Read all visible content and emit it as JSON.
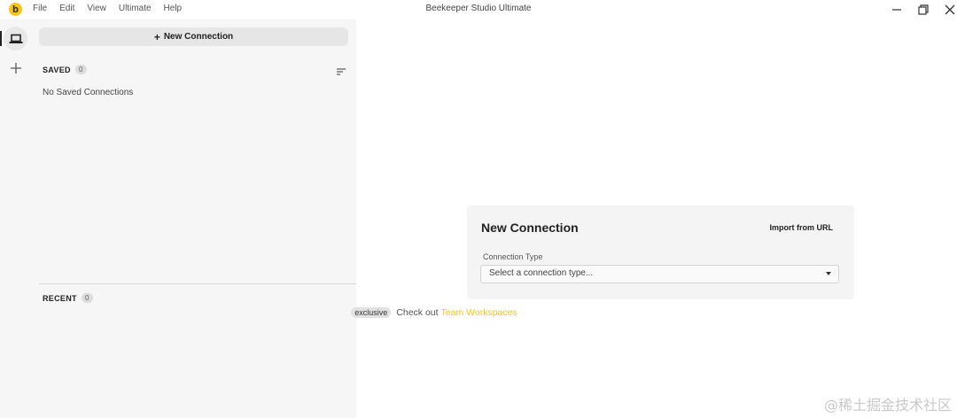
{
  "app": {
    "title": "Beekeeper Studio Ultimate",
    "logo_letter": "b",
    "accent_color": "#f5c518"
  },
  "menu": [
    {
      "label": "File"
    },
    {
      "label": "Edit"
    },
    {
      "label": "View"
    },
    {
      "label": "Ultimate"
    },
    {
      "label": "Help"
    }
  ],
  "window_controls": [
    "minimize-icon",
    "restore-icon",
    "close-icon"
  ],
  "rail": {
    "items": [
      {
        "icon": "laptop-icon",
        "active": true
      },
      {
        "icon": "plus-icon",
        "active": false
      }
    ]
  },
  "sidebar": {
    "new_connection_label": "New Connection",
    "saved": {
      "title": "SAVED",
      "count": "0",
      "empty_text": "No Saved Connections"
    },
    "recent": {
      "title": "RECENT",
      "count": "0"
    }
  },
  "main": {
    "card": {
      "title": "New Connection",
      "import_label": "Import from URL",
      "field_label": "Connection Type",
      "select_placeholder": "Select a connection type..."
    },
    "promo": {
      "badge": "exclusive",
      "text": "Check out",
      "link": "Team Workspaces"
    }
  },
  "watermark": "@稀土掘金技术社区"
}
